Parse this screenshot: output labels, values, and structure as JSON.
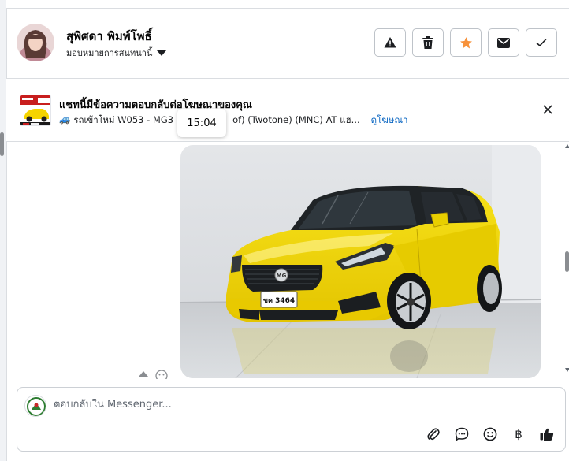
{
  "header": {
    "contact_name": "สุพิศดา พิมพ์โพธิ์",
    "assign_label": "มอบหมายการสนทนานี้",
    "buttons": [
      {
        "icon": "warning-icon"
      },
      {
        "icon": "trash-icon"
      },
      {
        "icon": "star-icon",
        "color": "#f7923b"
      },
      {
        "icon": "envelope-icon"
      },
      {
        "icon": "check-icon"
      }
    ]
  },
  "ad_banner": {
    "title": "แชทนี้มีข้อความตอบกลับต่อโฆษณาของคุณ",
    "emoji": "🚙",
    "description_start": "รถเข้าใหม่ W053 - MG3 1",
    "description_end": "of) (Twotone) (MNC) AT แฮ...",
    "link_label": "ดูโฆษณา"
  },
  "tooltip": {
    "time": "15:04"
  },
  "message": {
    "car_plate": "ขค 3464",
    "image_alt": "yellow MG3 hatchback"
  },
  "composer": {
    "placeholder": "ตอบกลับใน Messenger...",
    "icons": [
      "paperclip-icon",
      "speech-bubble-icon",
      "smiley-icon",
      "baht-icon",
      "thumbs-up-icon"
    ],
    "baht_symbol": "฿"
  },
  "colors": {
    "accent_link": "#0a66c2",
    "star": "#f7923b",
    "car_yellow": "#f5d400"
  }
}
